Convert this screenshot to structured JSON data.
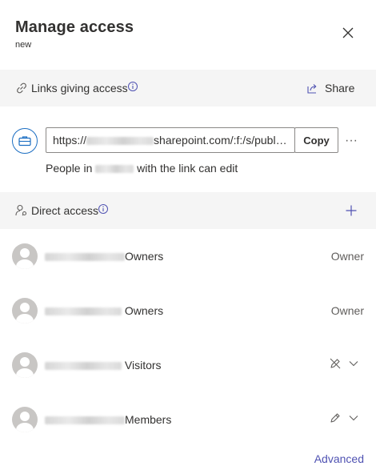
{
  "header": {
    "title": "Manage access",
    "subtitle": "new"
  },
  "links_section": {
    "label": "Links giving access",
    "share_label": "Share",
    "link": {
      "url": "https://███ sharepoint.com/:f:/s/public2...",
      "url_prefix": "https://",
      "url_suffix": "sharepoint.com/:f:/s/public2...",
      "copy_label": "Copy",
      "more_label": "···",
      "desc_prefix": "People in",
      "desc_suffix": "with the link can edit"
    }
  },
  "direct_section": {
    "label": "Direct access",
    "people": [
      {
        "name_suffix": "Owners",
        "role": "Owner",
        "role_kind": "text"
      },
      {
        "name_suffix": "Owners",
        "role": "Owner",
        "role_kind": "text"
      },
      {
        "name_suffix": "Visitors",
        "role": "Can view",
        "role_kind": "no-edit"
      },
      {
        "name_suffix": "Members",
        "role": "Can edit",
        "role_kind": "edit"
      }
    ]
  },
  "footer": {
    "advanced_label": "Advanced"
  },
  "colors": {
    "accent": "#4f52b2",
    "link_badge": "#1b6ec2",
    "section_bg": "#f5f5f5",
    "text": "#323130",
    "muted": "#605e5c"
  },
  "icons": {
    "close": "close-icon",
    "link": "link-icon",
    "info": "info-icon",
    "share": "share-icon",
    "direct": "person-key-icon",
    "add": "add-icon",
    "badge": "briefcase-icon",
    "edit": "pencil-icon",
    "no_edit": "pencil-slash-icon",
    "chevron": "chevron-down-icon"
  }
}
